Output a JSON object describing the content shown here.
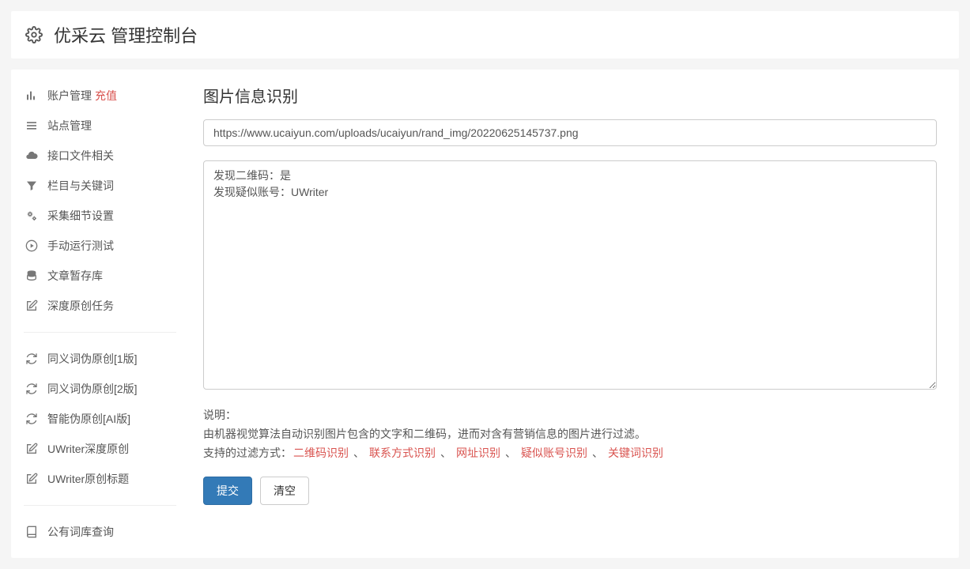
{
  "header": {
    "title": "优采云 管理控制台"
  },
  "sidebar": {
    "recharge_badge": "充值",
    "group1": [
      {
        "label": "账户管理",
        "icon": "bar-chart",
        "has_badge": true
      },
      {
        "label": "站点管理",
        "icon": "list"
      },
      {
        "label": "接口文件相关",
        "icon": "cloud"
      },
      {
        "label": "栏目与关键词",
        "icon": "filter"
      },
      {
        "label": "采集细节设置",
        "icon": "cogs"
      },
      {
        "label": "手动运行测试",
        "icon": "play-circle"
      },
      {
        "label": "文章暂存库",
        "icon": "database"
      },
      {
        "label": "深度原创任务",
        "icon": "edit"
      }
    ],
    "group2": [
      {
        "label": "同义词伪原创[1版]",
        "icon": "refresh"
      },
      {
        "label": "同义词伪原创[2版]",
        "icon": "refresh"
      },
      {
        "label": "智能伪原创[AI版]",
        "icon": "refresh"
      },
      {
        "label": "UWriter深度原创",
        "icon": "edit"
      },
      {
        "label": "UWriter原创标题",
        "icon": "edit"
      }
    ],
    "group3": [
      {
        "label": "公有词库查询",
        "icon": "book"
      }
    ]
  },
  "content": {
    "title": "图片信息识别",
    "url_value": "https://www.ucaiyun.com/uploads/ucaiyun/rand_img/20220625145737.png",
    "output_text": "发现二维码：是\n发现疑似账号：UWriter",
    "desc_label": "说明：",
    "desc_line1": "由机器视觉算法自动识别图片包含的文字和二维码，进而对含有营销信息的图片进行过滤。",
    "desc_prefix": "支持的过滤方式：",
    "tags": [
      "二维码识别",
      "联系方式识别",
      "网址识别",
      "疑似账号识别",
      "关键词识别"
    ],
    "separator": "、",
    "submit_label": "提交",
    "clear_label": "清空"
  }
}
